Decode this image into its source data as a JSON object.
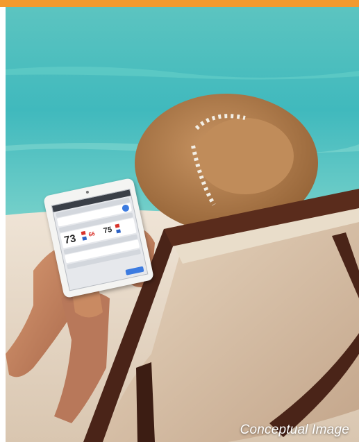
{
  "banner": {
    "color": "#f39a2e"
  },
  "photo": {
    "caption": "Conceptual Image"
  },
  "tablet_screen": {
    "big_temperature": "73",
    "set_low": "66",
    "set_high": "75"
  },
  "colors": {
    "sea": "#3fc1c4",
    "sand": "#e9ded0",
    "hat": "#b07a45",
    "chair_wood": "#4a2418",
    "canvas": "#dcc7ad"
  }
}
